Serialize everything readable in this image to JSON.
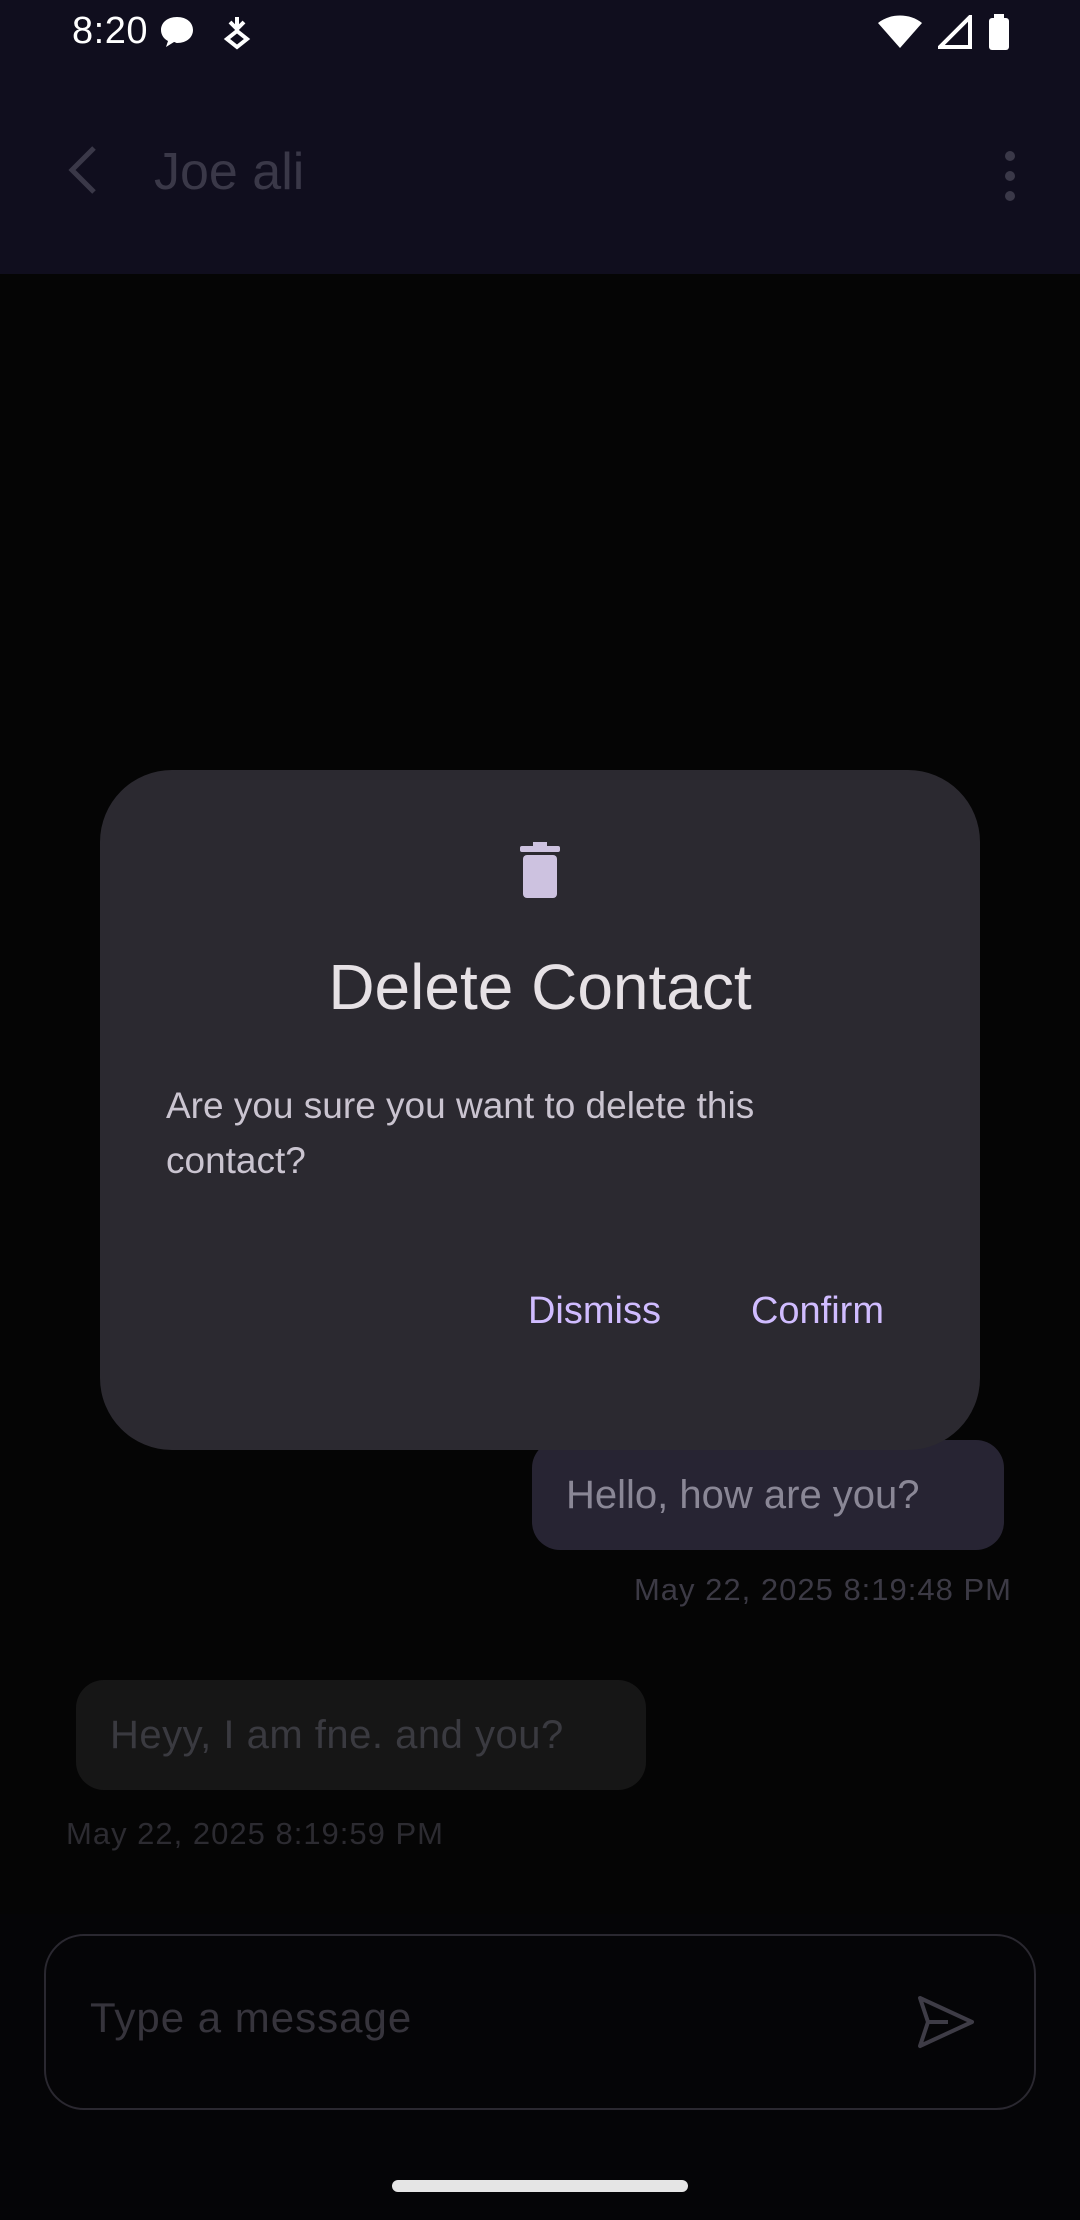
{
  "status_bar": {
    "time": "8:20",
    "icons": [
      "chat-bubble-icon",
      "download-icon",
      "wifi-icon",
      "signal-icon",
      "battery-icon"
    ]
  },
  "app_bar": {
    "title": "Joe ali",
    "icons": [
      "back-arrow-icon",
      "more-vert-icon"
    ]
  },
  "messages": [
    {
      "direction": "outgoing",
      "text": "Hello, how are you?",
      "timestamp": "May 22, 2025 8:19:48 PM"
    },
    {
      "direction": "incoming",
      "text": "Heyy, I am fne. and you?",
      "timestamp": "May 22, 2025 8:19:59 PM"
    }
  ],
  "composer": {
    "placeholder": "Type a message",
    "send_icon": "send-icon"
  },
  "dialog": {
    "icon": "trash-icon",
    "title": "Delete Contact",
    "body": "Are you sure you want to delete this contact?",
    "dismiss_label": "Dismiss",
    "confirm_label": "Confirm"
  },
  "colors": {
    "app_bar_bg": "#100e1e",
    "dialog_bg": "#2b2930",
    "accent": "#d0bcff"
  }
}
